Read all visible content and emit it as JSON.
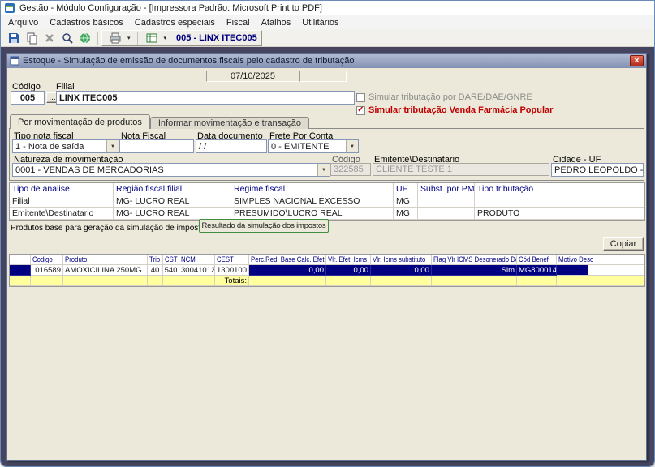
{
  "colors": {
    "mdi_background": "#45455f",
    "selection_navy": "#000080",
    "totals_yellow": "#ffff9e",
    "alert_red": "#c00000",
    "result_button_border": "#3f8f3f",
    "grid_header_text": "#000080"
  },
  "icons": {
    "dropdown": "▼",
    "dropdown_small": "▾",
    "close": "×",
    "check": "✓"
  },
  "window": {
    "title": "Gestão - Módulo Configuração - [Impressora Padrão: Microsoft Print to PDF]",
    "menu_items": [
      "Arquivo",
      "Cadastros básicos",
      "Cadastros especiais",
      "Fiscal",
      "Atalhos",
      "Utilitários"
    ],
    "toolbar": {
      "icon_names": [
        "save-icon",
        "copy-icon",
        "delete-icon",
        "search-icon",
        "globe-icon",
        "printer-icon",
        "table-icon"
      ],
      "company_label": "005 - LINX ITEC005"
    }
  },
  "dialog": {
    "title": "Estoque - Simulação de emissão de documentos fiscais pelo cadastro de tributação",
    "date": "07/10/2025",
    "codigo_label": "Código",
    "codigo_value": "005",
    "ellipsis": "...",
    "filial_label": "Filial",
    "filial_value": "LINX ITEC005",
    "checkbox_dare": "Simular tributação por DARE/DAE/GNRE",
    "checkbox_farmacia": "Simular tributação Venda Farmácia Popular",
    "tabs": [
      "Por movimentação de produtos",
      "Informar movimentação  e transação"
    ],
    "fields": {
      "tipo_nota_label": "Tipo nota fiscal",
      "tipo_nota_value": "1 - Nota de saída",
      "nota_fiscal_label": "Nota Fiscal",
      "nota_fiscal_value": "",
      "data_documento_label": "Data documento",
      "data_documento_value": "/  /",
      "frete_label": "Frete Por Conta",
      "frete_value": "0 - EMITENTE",
      "natureza_label": "Natureza de movimentação",
      "natureza_value": "0001 - VENDAS DE MERCADORIAS",
      "codigo2_label": "Código",
      "codigo2_value": "322585",
      "emitente_label": "Emitente\\Destinatario",
      "emitente_value": "CLIENTE TESTE 1",
      "cidade_label": "Cidade - UF",
      "cidade_value": "PEDRO LEOPOLDO - MG"
    },
    "analysis_grid": {
      "headers": [
        "Tipo de analise",
        "Região fiscal filial",
        "Regime fiscal",
        "UF",
        "Subst. por PMC",
        "Tipo tributação"
      ],
      "rows": [
        [
          "Filial",
          "MG- LUCRO REAL",
          "SIMPLES NACIONAL EXCESSO",
          "MG",
          "",
          ""
        ],
        [
          "Emitente\\Destinatario",
          "MG- LUCRO REAL",
          "PRESUMIDO\\LUCRO REAL",
          "MG",
          "",
          "PRODUTO"
        ]
      ]
    },
    "products_section_label": "Produtos base para geração da simulação de impostos",
    "result_button": "Resultado da simulação dos impostos",
    "copiar_button": "Copiar",
    "products_grid": {
      "headers": [
        "",
        "Codigo",
        "Produto",
        "Trib",
        "CST",
        "NCM",
        "CEST",
        "Perc.Red. Base Calc. Efet",
        "Vlr. Efet. Icms",
        "Vlr. Icms substituto",
        "Flag Vlr ICMS Desonerado Desc.",
        "Cód Benef",
        "Motivo Deso"
      ],
      "row": [
        "",
        "016589",
        "AMOXICILINA 250MG",
        "40",
        "540",
        "30041012",
        "1300100",
        "0,00",
        "0,00",
        "0,00",
        "Sim",
        "MG800014",
        ""
      ],
      "totals": [
        "",
        "",
        "",
        "",
        "",
        "",
        "Totais:",
        "",
        "",
        "",
        "",
        "",
        ""
      ]
    }
  }
}
